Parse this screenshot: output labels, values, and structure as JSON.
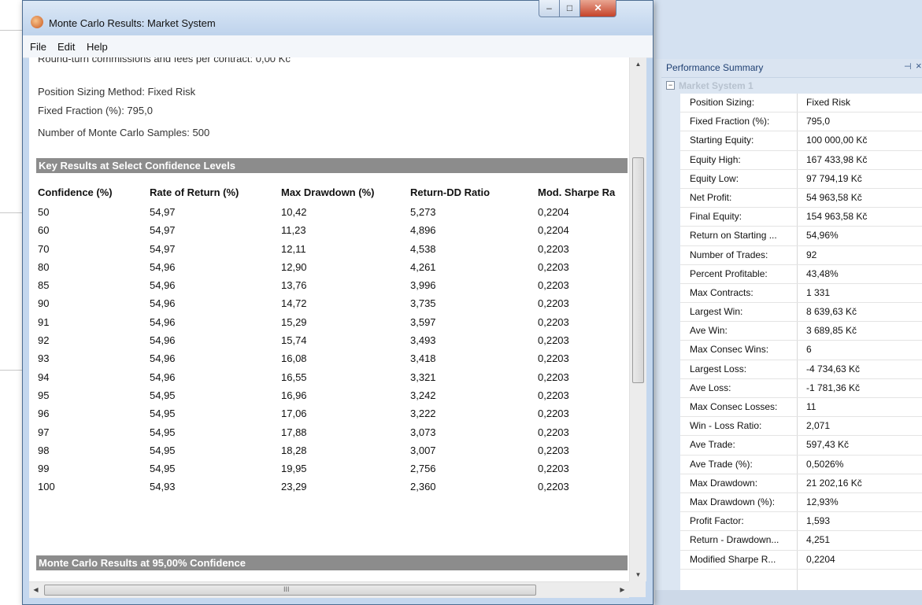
{
  "window": {
    "title": "Monte Carlo Results: Market System",
    "menu": [
      "File",
      "Edit",
      "Help"
    ],
    "cut_off_line": "Round-turn commissions and fees per contract: 0,00 Kč"
  },
  "report": {
    "info_lines": [
      "Position Sizing Method: Fixed Risk",
      "Fixed Fraction (%): 795,0",
      "Number of Monte Carlo Samples: 500"
    ],
    "section1_title": "Key Results at Select Confidence Levels",
    "columns": [
      "Confidence (%)",
      "Rate of Return (%)",
      "Max Drawdown (%)",
      "Return-DD Ratio",
      "Mod. Sharpe Ra"
    ],
    "rows": [
      [
        "50",
        "54,97",
        "10,42",
        "5,273",
        "0,2204"
      ],
      [
        "60",
        "54,97",
        "11,23",
        "4,896",
        "0,2204"
      ],
      [
        "70",
        "54,97",
        "12,11",
        "4,538",
        "0,2203"
      ],
      [
        "80",
        "54,96",
        "12,90",
        "4,261",
        "0,2203"
      ],
      [
        "85",
        "54,96",
        "13,76",
        "3,996",
        "0,2203"
      ],
      [
        "90",
        "54,96",
        "14,72",
        "3,735",
        "0,2203"
      ],
      [
        "91",
        "54,96",
        "15,29",
        "3,597",
        "0,2203"
      ],
      [
        "92",
        "54,96",
        "15,74",
        "3,493",
        "0,2203"
      ],
      [
        "93",
        "54,96",
        "16,08",
        "3,418",
        "0,2203"
      ],
      [
        "94",
        "54,96",
        "16,55",
        "3,321",
        "0,2203"
      ],
      [
        "95",
        "54,95",
        "16,96",
        "3,242",
        "0,2203"
      ],
      [
        "96",
        "54,95",
        "17,06",
        "3,222",
        "0,2203"
      ],
      [
        "97",
        "54,95",
        "17,88",
        "3,073",
        "0,2203"
      ],
      [
        "98",
        "54,95",
        "18,28",
        "3,007",
        "0,2203"
      ],
      [
        "99",
        "54,95",
        "19,95",
        "2,756",
        "0,2203"
      ],
      [
        "100",
        "54,93",
        "23,29",
        "2,360",
        "0,2203"
      ]
    ],
    "section2_title": "Monte Carlo Results at 95,00% Confidence",
    "hscroll_grip": "III"
  },
  "performance": {
    "title": "Performance Summary",
    "pin_icon": "pin-icon",
    "close_icon": "close-icon",
    "group": "Market System 1",
    "items": [
      {
        "label": "Position Sizing:",
        "value": "Fixed Risk"
      },
      {
        "label": "Fixed Fraction (%):",
        "value": "795,0"
      },
      {
        "label": "Starting Equity:",
        "value": "100 000,00 Kč"
      },
      {
        "label": "Equity High:",
        "value": "167 433,98 Kč"
      },
      {
        "label": "Equity Low:",
        "value": "97 794,19 Kč"
      },
      {
        "label": "Net Profit:",
        "value": "54 963,58 Kč"
      },
      {
        "label": "Final Equity:",
        "value": "154 963,58 Kč"
      },
      {
        "label": "Return on Starting ...",
        "value": "54,96%"
      },
      {
        "label": "Number of Trades:",
        "value": "92"
      },
      {
        "label": "Percent Profitable:",
        "value": "43,48%"
      },
      {
        "label": "Max Contracts:",
        "value": "1 331"
      },
      {
        "label": "Largest Win:",
        "value": "8 639,63 Kč"
      },
      {
        "label": "Ave Win:",
        "value": "3 689,85 Kč"
      },
      {
        "label": "Max Consec Wins:",
        "value": "6"
      },
      {
        "label": "Largest Loss:",
        "value": "-4 734,63 Kč"
      },
      {
        "label": "Ave Loss:",
        "value": "-1 781,36 Kč"
      },
      {
        "label": "Max Consec Losses:",
        "value": "11"
      },
      {
        "label": "Win - Loss Ratio:",
        "value": "2,071"
      },
      {
        "label": "Ave Trade:",
        "value": "597,43 Kč"
      },
      {
        "label": "Ave Trade (%):",
        "value": "0,5026%"
      },
      {
        "label": "Max Drawdown:",
        "value": "21 202,16 Kč"
      },
      {
        "label": "Max Drawdown (%):",
        "value": "12,93%"
      },
      {
        "label": "Profit Factor:",
        "value": "1,593"
      },
      {
        "label": "Return - Drawdown...",
        "value": "4,251"
      },
      {
        "label": "Modified Sharpe R...",
        "value": "0,2204"
      }
    ]
  }
}
